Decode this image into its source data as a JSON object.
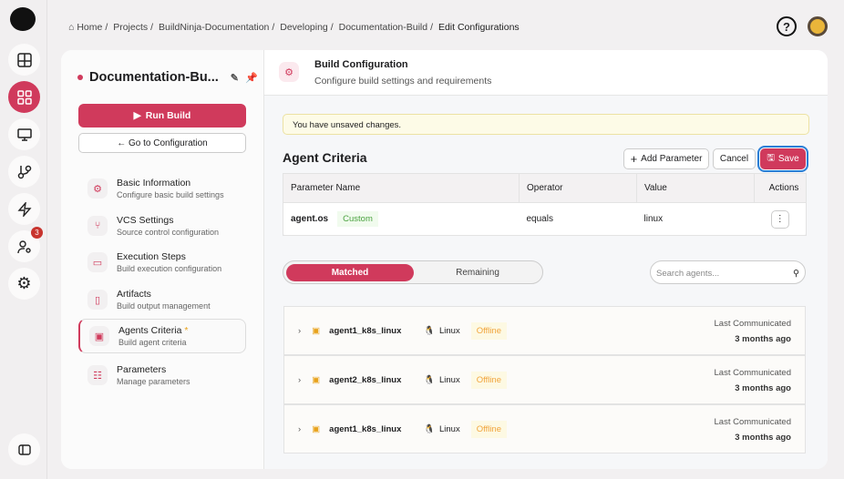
{
  "breadcrumb": [
    "Home",
    "Projects",
    "BuildNinja-Documentation",
    "Developing",
    "Documentation-Build",
    "Edit Configurations"
  ],
  "rail": {
    "badge_count": "3"
  },
  "sidebar": {
    "title": "Documentation-Bu...",
    "run_build": "Run Build",
    "goto_config": "← Go to Configuration",
    "items": [
      {
        "label": "Basic Information",
        "sub": "Configure basic build settings"
      },
      {
        "label": "VCS Settings",
        "sub": "Source control configuration"
      },
      {
        "label": "Execution Steps",
        "sub": "Build execution configuration"
      },
      {
        "label": "Artifacts",
        "sub": "Build output management"
      },
      {
        "label": "Agents Criteria",
        "sub": "Build agent criteria",
        "modified": "*"
      },
      {
        "label": "Parameters",
        "sub": "Manage parameters"
      }
    ]
  },
  "header": {
    "title": "Build Configuration",
    "subtitle": "Configure build settings and requirements"
  },
  "banner": "You have unsaved changes.",
  "section": {
    "title": "Agent Criteria",
    "add": "Add Parameter",
    "cancel": "Cancel",
    "save": "Save"
  },
  "table": {
    "headers": [
      "Parameter Name",
      "Operator",
      "Value",
      "Actions"
    ],
    "rows": [
      {
        "name": "agent.os",
        "tag": "Custom",
        "operator": "equals",
        "value": "linux"
      }
    ]
  },
  "tabs": {
    "matched": "Matched",
    "remaining": "Remaining"
  },
  "search": {
    "placeholder": "Search agents..."
  },
  "agents": [
    {
      "name": "agent1_k8s_linux",
      "os": "Linux",
      "status": "Offline",
      "lc_label": "Last Communicated",
      "lc": "3 months ago"
    },
    {
      "name": "agent2_k8s_linux",
      "os": "Linux",
      "status": "Offline",
      "lc_label": "Last Communicated",
      "lc": "3 months ago"
    },
    {
      "name": "agent1_k8s_linux",
      "os": "Linux",
      "status": "Offline",
      "lc_label": "Last Communicated",
      "lc": "3 months ago"
    }
  ]
}
